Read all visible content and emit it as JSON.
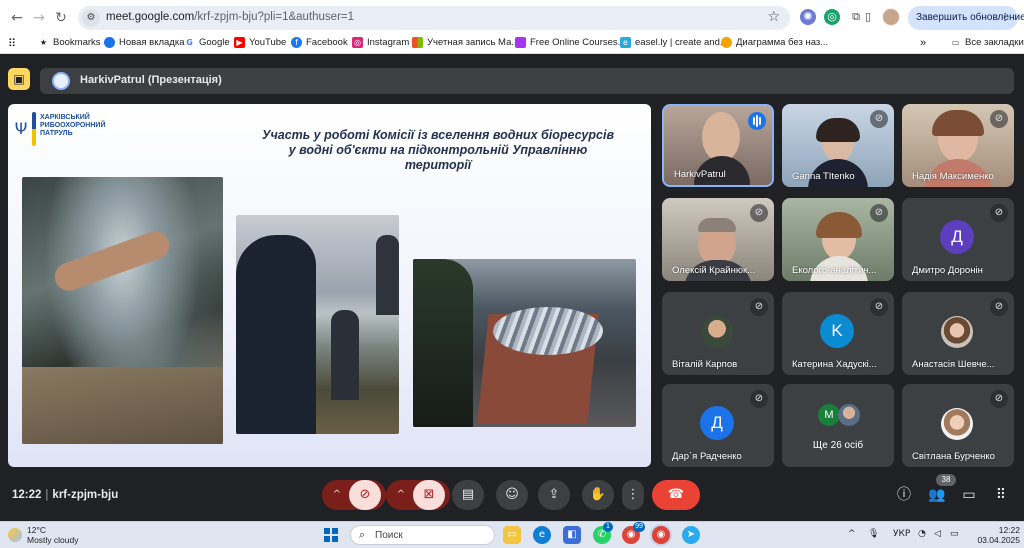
{
  "browser": {
    "url_main": "meet.google.com",
    "url_rest": "/krf-zpjm-bju?pli=1&authuser=1",
    "update_label": "Завершить обновление",
    "bookmarks": [
      {
        "label": "Bookmarks",
        "icon": "star-icon",
        "color": "#202124"
      },
      {
        "label": "Новая вкладка",
        "icon": "chrome-icon",
        "color": "#1a73e8"
      },
      {
        "label": "Google",
        "icon": "google-icon",
        "color": "#4285f4"
      },
      {
        "label": "YouTube",
        "icon": "youtube-icon",
        "color": "#ff0000"
      },
      {
        "label": "Facebook",
        "icon": "facebook-icon",
        "color": "#1877f2"
      },
      {
        "label": "Instagram",
        "icon": "instagram-icon",
        "color": "#d62976"
      },
      {
        "label": "Учетная запись Ма...",
        "icon": "microsoft-icon",
        "color": "#f25022"
      },
      {
        "label": "Free Online Courses...",
        "icon": "course-icon",
        "color": "#a435f0"
      },
      {
        "label": "easel.ly | create and...",
        "icon": "easelly-icon",
        "color": "#2aa8e0"
      },
      {
        "label": "Диаграмма без наз...",
        "icon": "diagram-icon",
        "color": "#f4a300"
      }
    ],
    "all_bookmarks": "Все закладки"
  },
  "meet": {
    "presentation_title": "HarkivPatrul (Презентація)",
    "meeting_time": "12:22",
    "meeting_code": "krf-zpjm-bju",
    "participants_count": "38"
  },
  "slide": {
    "org_name": "ХАРКІВСЬКИЙ РИБООХОРОННИЙ ПАТРУЛЬ",
    "heading": "Участь у роботі Комісії із вселення водних біоресурсів у водні об'єкти на підконтрольній Управлінню території"
  },
  "participants": [
    {
      "name": "HarkivPatrul"
    },
    {
      "name": "Ganna TItenko"
    },
    {
      "name": "Надія Максименко"
    },
    {
      "name": "Олексій Крайнюк..."
    },
    {
      "name": "Еколого-аналітич..."
    },
    {
      "name": "Дмитро Доронін",
      "initial": "Д",
      "color": "#5b3fbf"
    },
    {
      "name": "Віталій Карпов"
    },
    {
      "name": "Катерина Хадускі...",
      "initial": "K",
      "color": "#0b8bd1"
    },
    {
      "name": "Анастасія Шевче..."
    },
    {
      "name": "Дар`я Радченко",
      "initial": "Д",
      "color": "#1a73e8"
    },
    {
      "name": "Ще 26 осіб",
      "initial": "M",
      "color": "#188038"
    },
    {
      "name": "Світлана Бурченко"
    }
  ],
  "taskbar": {
    "temp": "12°C",
    "weather": "Mostly cloudy",
    "search": "Поиск",
    "lang": "УКР",
    "time": "12:22",
    "date": "03.04.2025",
    "badge_a": "1",
    "badge_b": "99"
  }
}
